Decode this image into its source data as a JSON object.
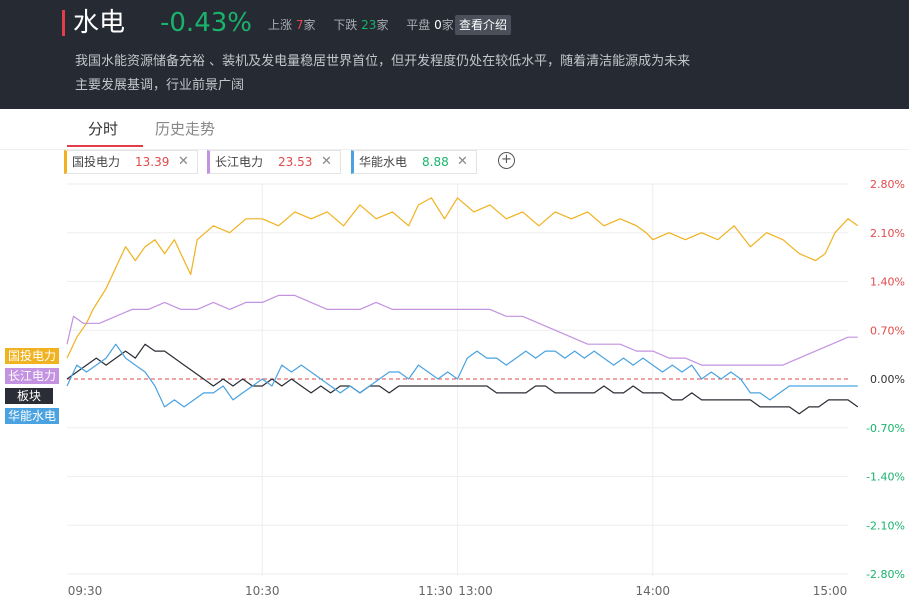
{
  "header": {
    "title": "水电",
    "change": "-0.43%",
    "stats": {
      "up_label": "上涨",
      "up_count": "7",
      "up_unit": "家",
      "down_label": "下跌",
      "down_count": "23",
      "down_unit": "家",
      "flat_label": "平盘",
      "flat_count": "0",
      "flat_unit": "家"
    },
    "intro_button": "查看介绍",
    "description": "我国水能资源储备充裕 、装机及发电量稳居世界首位，但开发程度仍处在较低水平，随着清洁能源成为未来主要发展基调，行业前景广阔"
  },
  "tabs": [
    {
      "label": "分时",
      "active": true
    },
    {
      "label": "历史走势",
      "active": false
    }
  ],
  "chips": [
    {
      "name": "国投电力",
      "value": "13.39",
      "color": "#f0b21e",
      "value_color": "#e24a4a"
    },
    {
      "name": "长江电力",
      "value": "23.53",
      "color": "#c392e0",
      "value_color": "#e24a4a"
    },
    {
      "name": "华能水电",
      "value": "8.88",
      "color": "#4aa3e0",
      "value_color": "#19b36b"
    }
  ],
  "add_icon": "plus-circle-icon",
  "legend_tags": [
    {
      "label": "国投电力",
      "color": "#f0b21e"
    },
    {
      "label": "长江电力",
      "color": "#c392e0"
    },
    {
      "label": "板块",
      "color": "#2a2d35"
    },
    {
      "label": "华能水电",
      "color": "#4aa3e0"
    }
  ],
  "chart_data": {
    "type": "line",
    "y_unit": "%",
    "y_ticks": [
      "2.80%",
      "2.10%",
      "1.40%",
      "0.70%",
      "0.00%",
      "-0.70%",
      "-1.40%",
      "-2.10%",
      "-2.80%"
    ],
    "y_tick_values": [
      2.8,
      2.1,
      1.4,
      0.7,
      0.0,
      -0.7,
      -1.4,
      -2.1,
      -2.8
    ],
    "ylim": [
      -2.8,
      2.8
    ],
    "x_ticks": [
      "09:30",
      "10:30",
      "11:30",
      "13:00",
      "14:00",
      "15:00"
    ],
    "x_positions_minutes": [
      0,
      60,
      120,
      120,
      180,
      240
    ],
    "x_range_minutes": [
      0,
      240
    ],
    "colors": {
      "up": "#e24a4a",
      "down": "#19b36b",
      "zero": "#333333",
      "grid": "#eeeeee"
    },
    "series": [
      {
        "name": "国投电力",
        "color": "#f0b21e",
        "points": [
          [
            0,
            0.3
          ],
          [
            3,
            0.6
          ],
          [
            6,
            0.8
          ],
          [
            8,
            1.0
          ],
          [
            12,
            1.3
          ],
          [
            15,
            1.6
          ],
          [
            18,
            1.9
          ],
          [
            21,
            1.7
          ],
          [
            24,
            1.9
          ],
          [
            27,
            2.0
          ],
          [
            30,
            1.8
          ],
          [
            33,
            2.0
          ],
          [
            36,
            1.7
          ],
          [
            38,
            1.5
          ],
          [
            40,
            2.0
          ],
          [
            45,
            2.2
          ],
          [
            50,
            2.1
          ],
          [
            55,
            2.3
          ],
          [
            60,
            2.3
          ],
          [
            65,
            2.2
          ],
          [
            70,
            2.4
          ],
          [
            75,
            2.3
          ],
          [
            80,
            2.4
          ],
          [
            85,
            2.2
          ],
          [
            90,
            2.5
          ],
          [
            95,
            2.3
          ],
          [
            100,
            2.4
          ],
          [
            105,
            2.2
          ],
          [
            108,
            2.5
          ],
          [
            112,
            2.6
          ],
          [
            116,
            2.3
          ],
          [
            120,
            2.6
          ],
          [
            125,
            2.4
          ],
          [
            130,
            2.5
          ],
          [
            135,
            2.3
          ],
          [
            140,
            2.4
          ],
          [
            145,
            2.2
          ],
          [
            150,
            2.4
          ],
          [
            155,
            2.3
          ],
          [
            160,
            2.4
          ],
          [
            165,
            2.2
          ],
          [
            170,
            2.3
          ],
          [
            175,
            2.2
          ],
          [
            178,
            2.1
          ],
          [
            180,
            2.0
          ],
          [
            185,
            2.1
          ],
          [
            190,
            2.0
          ],
          [
            195,
            2.1
          ],
          [
            200,
            2.0
          ],
          [
            205,
            2.2
          ],
          [
            210,
            1.9
          ],
          [
            215,
            2.1
          ],
          [
            220,
            2.0
          ],
          [
            225,
            1.8
          ],
          [
            230,
            1.7
          ],
          [
            233,
            1.8
          ],
          [
            236,
            2.1
          ],
          [
            240,
            2.3
          ],
          [
            243,
            2.2
          ]
        ]
      },
      {
        "name": "长江电力",
        "color": "#c392e0",
        "points": [
          [
            0,
            0.5
          ],
          [
            2,
            0.9
          ],
          [
            5,
            0.8
          ],
          [
            10,
            0.8
          ],
          [
            15,
            0.9
          ],
          [
            20,
            1.0
          ],
          [
            25,
            1.0
          ],
          [
            30,
            1.1
          ],
          [
            35,
            1.0
          ],
          [
            40,
            1.0
          ],
          [
            45,
            1.1
          ],
          [
            50,
            1.0
          ],
          [
            55,
            1.1
          ],
          [
            60,
            1.1
          ],
          [
            65,
            1.2
          ],
          [
            70,
            1.2
          ],
          [
            75,
            1.1
          ],
          [
            80,
            1.0
          ],
          [
            85,
            1.0
          ],
          [
            90,
            1.0
          ],
          [
            95,
            1.1
          ],
          [
            100,
            1.0
          ],
          [
            105,
            1.0
          ],
          [
            110,
            1.0
          ],
          [
            115,
            1.0
          ],
          [
            120,
            1.0
          ],
          [
            125,
            1.0
          ],
          [
            130,
            1.0
          ],
          [
            135,
            0.9
          ],
          [
            140,
            0.9
          ],
          [
            145,
            0.8
          ],
          [
            150,
            0.7
          ],
          [
            155,
            0.6
          ],
          [
            160,
            0.5
          ],
          [
            165,
            0.5
          ],
          [
            170,
            0.5
          ],
          [
            175,
            0.4
          ],
          [
            180,
            0.4
          ],
          [
            185,
            0.3
          ],
          [
            190,
            0.3
          ],
          [
            195,
            0.2
          ],
          [
            200,
            0.2
          ],
          [
            205,
            0.2
          ],
          [
            210,
            0.2
          ],
          [
            215,
            0.2
          ],
          [
            220,
            0.2
          ],
          [
            225,
            0.3
          ],
          [
            230,
            0.4
          ],
          [
            235,
            0.5
          ],
          [
            240,
            0.6
          ],
          [
            243,
            0.6
          ]
        ]
      },
      {
        "name": "板块",
        "color": "#2a2d35",
        "points": [
          [
            0,
            0.0
          ],
          [
            3,
            0.1
          ],
          [
            6,
            0.2
          ],
          [
            9,
            0.3
          ],
          [
            12,
            0.2
          ],
          [
            15,
            0.3
          ],
          [
            18,
            0.4
          ],
          [
            21,
            0.3
          ],
          [
            24,
            0.5
          ],
          [
            27,
            0.4
          ],
          [
            30,
            0.4
          ],
          [
            33,
            0.3
          ],
          [
            36,
            0.2
          ],
          [
            39,
            0.1
          ],
          [
            42,
            0.0
          ],
          [
            45,
            -0.1
          ],
          [
            48,
            0.0
          ],
          [
            51,
            -0.1
          ],
          [
            54,
            0.0
          ],
          [
            57,
            -0.1
          ],
          [
            60,
            -0.1
          ],
          [
            63,
            0.0
          ],
          [
            66,
            -0.1
          ],
          [
            69,
            0.0
          ],
          [
            72,
            -0.1
          ],
          [
            75,
            -0.2
          ],
          [
            78,
            -0.1
          ],
          [
            81,
            -0.2
          ],
          [
            84,
            -0.1
          ],
          [
            87,
            -0.1
          ],
          [
            90,
            -0.2
          ],
          [
            93,
            -0.1
          ],
          [
            96,
            -0.1
          ],
          [
            99,
            -0.2
          ],
          [
            102,
            -0.1
          ],
          [
            105,
            -0.1
          ],
          [
            108,
            -0.1
          ],
          [
            111,
            -0.1
          ],
          [
            114,
            -0.1
          ],
          [
            117,
            -0.1
          ],
          [
            120,
            -0.1
          ],
          [
            123,
            -0.1
          ],
          [
            126,
            -0.1
          ],
          [
            129,
            -0.1
          ],
          [
            132,
            -0.2
          ],
          [
            135,
            -0.2
          ],
          [
            138,
            -0.2
          ],
          [
            141,
            -0.2
          ],
          [
            144,
            -0.1
          ],
          [
            147,
            -0.1
          ],
          [
            150,
            -0.2
          ],
          [
            153,
            -0.2
          ],
          [
            156,
            -0.2
          ],
          [
            159,
            -0.2
          ],
          [
            162,
            -0.2
          ],
          [
            165,
            -0.1
          ],
          [
            168,
            -0.2
          ],
          [
            171,
            -0.2
          ],
          [
            174,
            -0.1
          ],
          [
            177,
            -0.2
          ],
          [
            180,
            -0.2
          ],
          [
            183,
            -0.2
          ],
          [
            186,
            -0.3
          ],
          [
            189,
            -0.3
          ],
          [
            192,
            -0.2
          ],
          [
            195,
            -0.3
          ],
          [
            198,
            -0.3
          ],
          [
            201,
            -0.3
          ],
          [
            204,
            -0.3
          ],
          [
            207,
            -0.3
          ],
          [
            210,
            -0.3
          ],
          [
            213,
            -0.4
          ],
          [
            216,
            -0.4
          ],
          [
            219,
            -0.4
          ],
          [
            222,
            -0.4
          ],
          [
            225,
            -0.5
          ],
          [
            228,
            -0.4
          ],
          [
            231,
            -0.4
          ],
          [
            234,
            -0.3
          ],
          [
            237,
            -0.3
          ],
          [
            240,
            -0.3
          ],
          [
            243,
            -0.4
          ]
        ]
      },
      {
        "name": "华能水电",
        "color": "#4aa3e0",
        "points": [
          [
            0,
            -0.1
          ],
          [
            3,
            0.2
          ],
          [
            6,
            0.1
          ],
          [
            9,
            0.2
          ],
          [
            12,
            0.3
          ],
          [
            15,
            0.5
          ],
          [
            18,
            0.3
          ],
          [
            21,
            0.2
          ],
          [
            24,
            0.1
          ],
          [
            27,
            -0.1
          ],
          [
            30,
            -0.4
          ],
          [
            33,
            -0.3
          ],
          [
            36,
            -0.4
          ],
          [
            39,
            -0.3
          ],
          [
            42,
            -0.2
          ],
          [
            45,
            -0.2
          ],
          [
            48,
            -0.1
          ],
          [
            51,
            -0.3
          ],
          [
            54,
            -0.2
          ],
          [
            57,
            -0.1
          ],
          [
            60,
            0.0
          ],
          [
            63,
            -0.1
          ],
          [
            66,
            0.2
          ],
          [
            69,
            0.1
          ],
          [
            72,
            0.2
          ],
          [
            75,
            0.1
          ],
          [
            78,
            0.0
          ],
          [
            81,
            -0.1
          ],
          [
            84,
            -0.2
          ],
          [
            87,
            -0.1
          ],
          [
            90,
            -0.2
          ],
          [
            93,
            -0.1
          ],
          [
            96,
            0.0
          ],
          [
            99,
            0.1
          ],
          [
            102,
            0.1
          ],
          [
            105,
            0.0
          ],
          [
            108,
            0.2
          ],
          [
            111,
            0.1
          ],
          [
            114,
            0.0
          ],
          [
            117,
            0.1
          ],
          [
            120,
            0.0
          ],
          [
            123,
            0.3
          ],
          [
            126,
            0.4
          ],
          [
            129,
            0.3
          ],
          [
            132,
            0.3
          ],
          [
            135,
            0.2
          ],
          [
            138,
            0.3
          ],
          [
            141,
            0.4
          ],
          [
            144,
            0.3
          ],
          [
            147,
            0.4
          ],
          [
            150,
            0.4
          ],
          [
            153,
            0.3
          ],
          [
            156,
            0.4
          ],
          [
            159,
            0.3
          ],
          [
            162,
            0.4
          ],
          [
            165,
            0.3
          ],
          [
            168,
            0.2
          ],
          [
            171,
            0.3
          ],
          [
            174,
            0.2
          ],
          [
            177,
            0.3
          ],
          [
            180,
            0.2
          ],
          [
            183,
            0.1
          ],
          [
            186,
            0.2
          ],
          [
            189,
            0.1
          ],
          [
            192,
            0.2
          ],
          [
            195,
            0.0
          ],
          [
            198,
            0.1
          ],
          [
            201,
            0.0
          ],
          [
            204,
            0.1
          ],
          [
            207,
            0.0
          ],
          [
            210,
            -0.2
          ],
          [
            213,
            -0.2
          ],
          [
            216,
            -0.3
          ],
          [
            219,
            -0.2
          ],
          [
            222,
            -0.1
          ],
          [
            225,
            -0.1
          ],
          [
            228,
            -0.1
          ],
          [
            231,
            -0.1
          ],
          [
            234,
            -0.1
          ],
          [
            237,
            -0.1
          ],
          [
            240,
            -0.1
          ],
          [
            243,
            -0.1
          ]
        ]
      }
    ]
  }
}
